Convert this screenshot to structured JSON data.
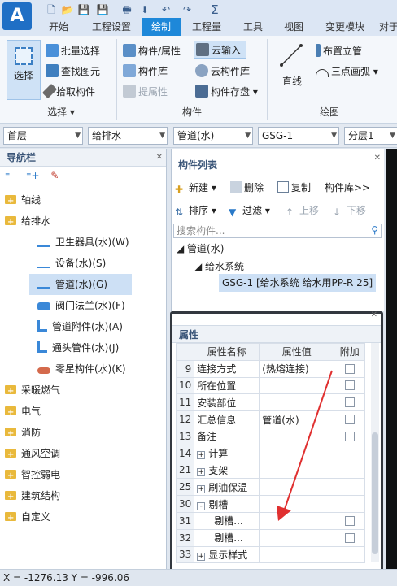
{
  "app": {
    "logo": "A"
  },
  "quick_access": [
    "new-file-icon",
    "open-folder-icon",
    "save-icon",
    "print-icon",
    "undo-icon",
    "redo-icon",
    "sum-icon"
  ],
  "tabs": [
    "开始",
    "工程设置",
    "绘制",
    "工程量",
    "工具",
    "视图",
    "变更模块",
    "对于"
  ],
  "active_tab": "绘制",
  "ribbon": {
    "select_big": "选择",
    "batch_select": "批量选择",
    "find_element": "查找图元",
    "pick_component": "拾取构件",
    "select_group": "选择",
    "component_attr": "构件/属性",
    "component_lib": "构件库",
    "extract_attr": "提属性",
    "cloud_input": "云输入",
    "cloud_lib": "云构件库",
    "component_save": "构件存盘",
    "component_group": "构件",
    "line": "直线",
    "layout_riser": "布置立管",
    "three_point_arc": "三点画弧",
    "draw_group": "绘图"
  },
  "combos": [
    "首层",
    "给排水",
    "管道(水)",
    "GSG-1",
    "分层1"
  ],
  "nav": {
    "title": "导航栏",
    "items": [
      {
        "label": "轴线",
        "level": 0,
        "type": "folder"
      },
      {
        "label": "给排水",
        "level": 0,
        "type": "folder"
      },
      {
        "label": "卫生器具(水)(W)",
        "level": 1,
        "type": "item"
      },
      {
        "label": "设备(水)(S)",
        "level": 1,
        "type": "item"
      },
      {
        "label": "管道(水)(G)",
        "level": 1,
        "type": "item",
        "selected": true
      },
      {
        "label": "阀门法兰(水)(F)",
        "level": 1,
        "type": "item"
      },
      {
        "label": "管道附件(水)(A)",
        "level": 1,
        "type": "item"
      },
      {
        "label": "通头管件(水)(J)",
        "level": 1,
        "type": "item"
      },
      {
        "label": "零星构件(水)(K)",
        "level": 1,
        "type": "item"
      },
      {
        "label": "采暖燃气",
        "level": 0,
        "type": "folder"
      },
      {
        "label": "电气",
        "level": 0,
        "type": "folder"
      },
      {
        "label": "消防",
        "level": 0,
        "type": "folder"
      },
      {
        "label": "通风空调",
        "level": 0,
        "type": "folder"
      },
      {
        "label": "智控弱电",
        "level": 0,
        "type": "folder"
      },
      {
        "label": "建筑结构",
        "level": 0,
        "type": "folder"
      },
      {
        "label": "自定义",
        "level": 0,
        "type": "folder"
      }
    ]
  },
  "component_list": {
    "title": "构件列表",
    "new": "新建",
    "delete": "删除",
    "copy": "复制",
    "library": "构件库>>",
    "sort": "排序",
    "filter": "过滤",
    "move_up": "上移",
    "move_down": "下移",
    "search_placeholder": "搜索构件...",
    "tree": [
      {
        "label": "管道(水)",
        "level": 0
      },
      {
        "label": "给水系统",
        "level": 1
      },
      {
        "label": "GSG-1 [给水系统 给水用PP-R 25]",
        "level": 2,
        "selected": true
      }
    ]
  },
  "properties": {
    "title": "属性",
    "headers": [
      "属性名称",
      "属性值",
      "附加"
    ],
    "rows": [
      {
        "num": "9",
        "name": "连接方式",
        "value": "(热熔连接)",
        "check": true
      },
      {
        "num": "10",
        "name": "所在位置",
        "value": "",
        "check": true
      },
      {
        "num": "11",
        "name": "安装部位",
        "value": "",
        "check": true
      },
      {
        "num": "12",
        "name": "汇总信息",
        "value": "管道(水)",
        "check": true
      },
      {
        "num": "13",
        "name": "备注",
        "value": "",
        "check": true
      },
      {
        "num": "14",
        "name": "计算",
        "value": "",
        "expand": "+",
        "check": false
      },
      {
        "num": "21",
        "name": "支架",
        "value": "",
        "expand": "+",
        "check": false
      },
      {
        "num": "25",
        "name": "刷油保温",
        "value": "",
        "expand": "+",
        "check": false
      },
      {
        "num": "30",
        "name": "剔槽",
        "value": "",
        "expand": "-",
        "check": false
      },
      {
        "num": "31",
        "name": "剔槽...",
        "value": "",
        "indent": true,
        "check": true
      },
      {
        "num": "32",
        "name": "剔槽...",
        "value": "",
        "indent": true,
        "check": true
      },
      {
        "num": "33",
        "name": "显示样式",
        "value": "",
        "expand": "+",
        "check": false
      }
    ]
  },
  "status": {
    "coords": "X = -1276.13 Y = -996.06"
  },
  "colors": {
    "accent": "#1e88d9",
    "arrow": "#e03030",
    "selection": "#cde0f5"
  }
}
